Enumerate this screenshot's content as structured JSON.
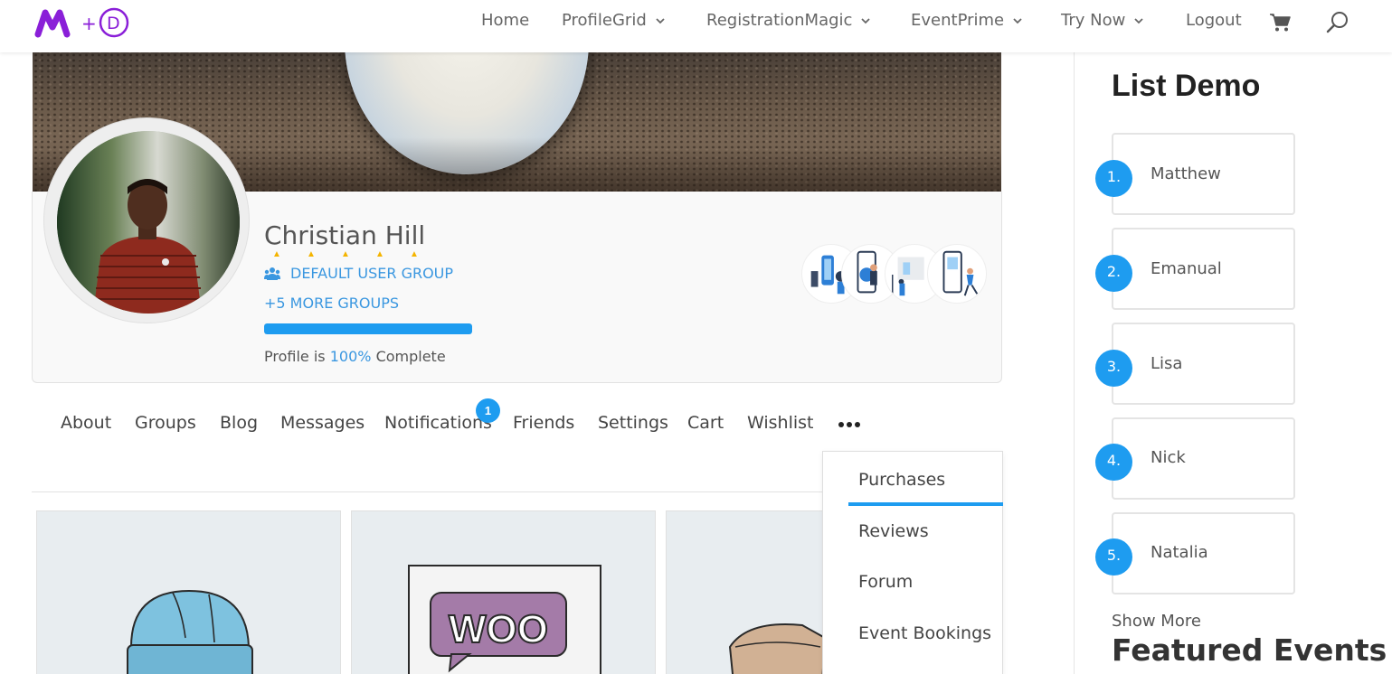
{
  "header": {
    "logo_text": "M+D",
    "nav": [
      {
        "label": "Home",
        "has_dropdown": false
      },
      {
        "label": "ProfileGrid",
        "has_dropdown": true
      },
      {
        "label": "RegistrationMagic",
        "has_dropdown": true
      },
      {
        "label": "EventPrime",
        "has_dropdown": true
      },
      {
        "label": "Try Now",
        "has_dropdown": true
      },
      {
        "label": "Logout",
        "has_dropdown": false
      }
    ],
    "cart_icon": "cart-icon",
    "search_icon": "search-icon"
  },
  "profile": {
    "name": "Christian Hill",
    "rating_stars": 5,
    "group_icon": "users-icon",
    "group": "DEFAULT USER GROUP",
    "more_groups": "+5 MORE GROUPS",
    "completion": 100,
    "completion_prefix": "Profile is",
    "completion_value": "100%",
    "completion_suffix": "Complete"
  },
  "tabs": {
    "items": [
      "About",
      "Groups",
      "Blog",
      "Messages",
      "Notifications",
      "Friends",
      "Settings",
      "Cart",
      "Wishlist"
    ],
    "notification_count": "1",
    "more_icon": "more-horizontal-icon",
    "dropdown": [
      "Purchases",
      "Reviews",
      "Forum",
      "Event Bookings"
    ],
    "dropdown_active": "Purchases"
  },
  "sidebar": {
    "title": "List Demo",
    "items": [
      {
        "num": "1.",
        "name": "Matthew"
      },
      {
        "num": "2.",
        "name": "Emanual"
      },
      {
        "num": "3.",
        "name": "Lisa"
      },
      {
        "num": "4.",
        "name": "Nick"
      },
      {
        "num": "5.",
        "name": "Natalia"
      }
    ],
    "show_more": "Show More",
    "featured_title": "Featured Events"
  },
  "products": {
    "woo_label": "WOO"
  },
  "colors": {
    "accent": "#1e9cf0",
    "link": "#3a97e0",
    "star": "#f4b400"
  }
}
